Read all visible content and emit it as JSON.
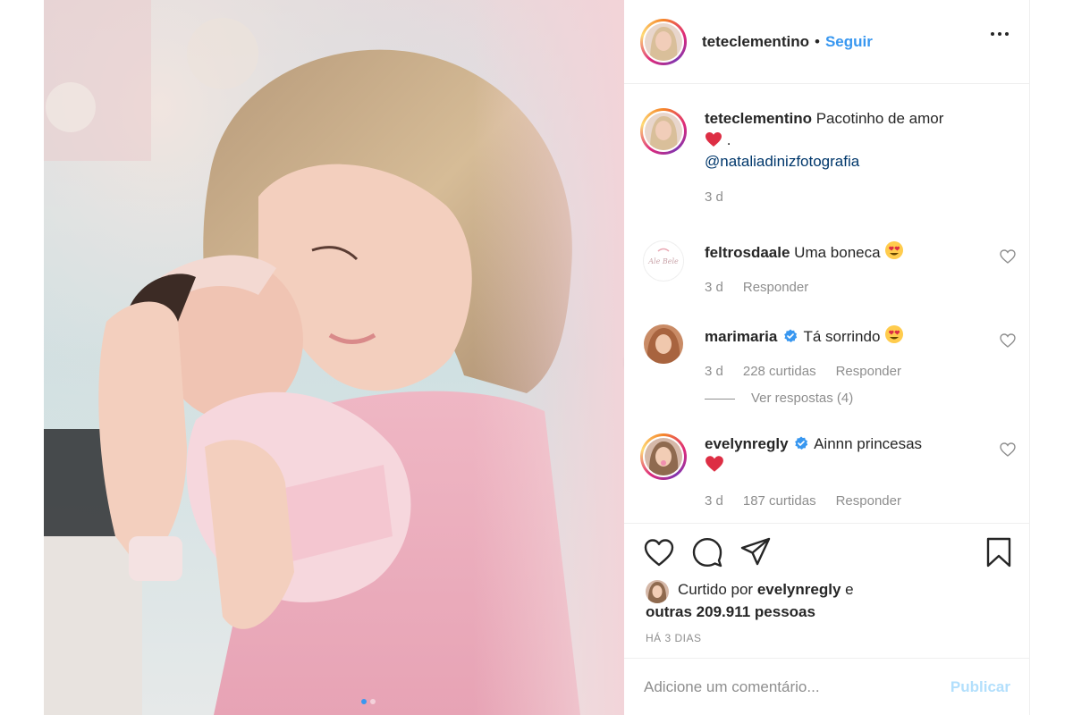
{
  "post": {
    "username": "teteclementino",
    "separator": "•",
    "follow_label": "Seguir"
  },
  "caption": {
    "username": "teteclementino",
    "text": "Pacotinho de amor",
    "after_emoji": ".",
    "mention": "@nataliadinizfotografia",
    "time": "3 d"
  },
  "comments": [
    {
      "username": "feltrosdaale",
      "text": "Uma boneca",
      "emoji": "heart-eyes-emoji",
      "time": "3 d",
      "reply_label": "Responder",
      "avatar_text": "Ale Bele"
    },
    {
      "username": "marimaria",
      "verified": true,
      "text": "Tá sorrindo",
      "emoji": "heart-eyes-emoji",
      "time": "3 d",
      "likes": "228 curtidas",
      "reply_label": "Responder",
      "view_replies": "Ver respostas (4)"
    },
    {
      "username": "evelynregly",
      "verified": true,
      "text": "Ainnn princesas",
      "emoji": "red-heart-emoji",
      "time": "3 d",
      "likes": "187 curtidas",
      "reply_label": "Responder"
    }
  ],
  "likes": {
    "prefix": "Curtido por",
    "user": "evelynregly",
    "conj": "e",
    "others": "outras 209.911 pessoas"
  },
  "timestamp": "HÁ 3 DIAS",
  "add_comment": {
    "placeholder": "Adicione um comentário...",
    "publish_label": "Publicar"
  },
  "colors": {
    "link_blue": "#3897f0",
    "mention_blue": "#00376b",
    "muted_gray": "#8e8e8e",
    "publish_disabled": "#b2dffc",
    "verified_blue": "#3897f0"
  },
  "icons": [
    "more-options-icon",
    "heart-icon",
    "comment-icon",
    "share-icon",
    "bookmark-icon",
    "next-arrow-icon",
    "verified-icon"
  ],
  "carousel": {
    "slides": 2,
    "active": 1
  }
}
